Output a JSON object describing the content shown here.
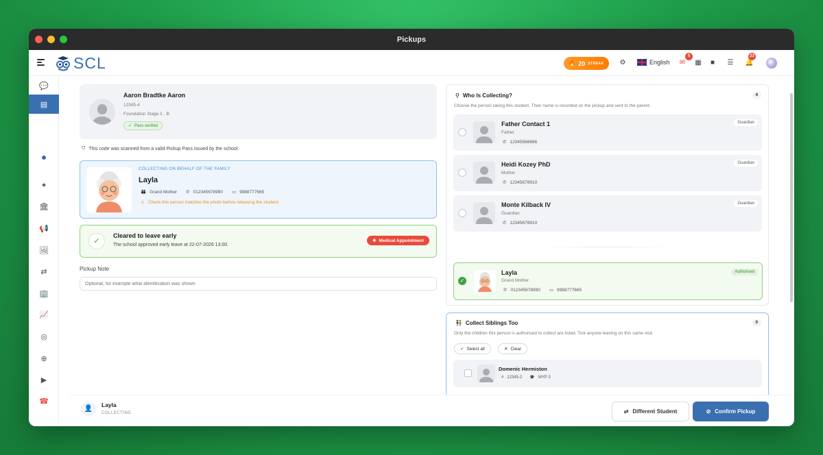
{
  "window": {
    "title": "Pickups"
  },
  "topbar": {
    "logo_text": "SCL",
    "streak_count": "20",
    "streak_label": "STREAK",
    "language": "English",
    "mail_badge": "5",
    "notif_badge": "23"
  },
  "student": {
    "name": "Aaron Bradtke Aaron",
    "id": "12345-4",
    "class": "Foundation Stage 1 · B",
    "pass_status": "Pass verified",
    "scan_note": "This code was scanned from a valid Pickup Pass issued by the school."
  },
  "collector": {
    "caption": "COLLECTING ON BEHALF OF THE FAMILY",
    "name": "Layla",
    "relation": "Grand Mother",
    "phone": "012345678990",
    "id_number": "9988777665",
    "warning": "Check this person matches the photo before releasing the student."
  },
  "early_leave": {
    "title": "Cleared to leave early",
    "detail": "The school approved early leave at 22-07-2026 13:00.",
    "reason": "Medical Appointment"
  },
  "pickup_note": {
    "label": "Pickup Note",
    "placeholder": "Optional, for example what identification was shown"
  },
  "who_collecting": {
    "title": "Who Is Collecting?",
    "count": "4",
    "subtitle": "Choose the person taking this student. Their name is recorded on the pickup and sent to the parent.",
    "people": [
      {
        "name": "Father Contact 1",
        "relation": "Father",
        "phone": "12345566666",
        "tag": "Guardian"
      },
      {
        "name": "Heidi Kozey PhD",
        "relation": "Mother",
        "phone": "12345678910",
        "tag": "Guardian"
      },
      {
        "name": "Monte Kilback IV",
        "relation": "Guardian",
        "phone": "12345678910",
        "tag": "Guardian"
      }
    ],
    "selected": {
      "name": "Layla",
      "relation": "Grand Mother",
      "phone": "012345678990",
      "id_number": "9988777665",
      "tag": "Authorised"
    }
  },
  "siblings": {
    "title": "Collect Siblings Too",
    "count": "0",
    "subtitle": "Only the children this person is authorised to collect are listed. Tick anyone leaving on this same visit.",
    "select_all": "Select all",
    "clear": "Clear",
    "items": [
      {
        "name": "Domenic Hermiston",
        "id": "12345-2",
        "grade": "MYP 3"
      }
    ]
  },
  "footer": {
    "collector_name": "Layla",
    "collector_status": "COLLECTING",
    "different_student": "Different Student",
    "confirm": "Confirm Pickup"
  },
  "colors": {
    "brand": "#3a6fb0",
    "success": "#43a047",
    "warning": "#f08c1a",
    "danger": "#e84b3c"
  }
}
